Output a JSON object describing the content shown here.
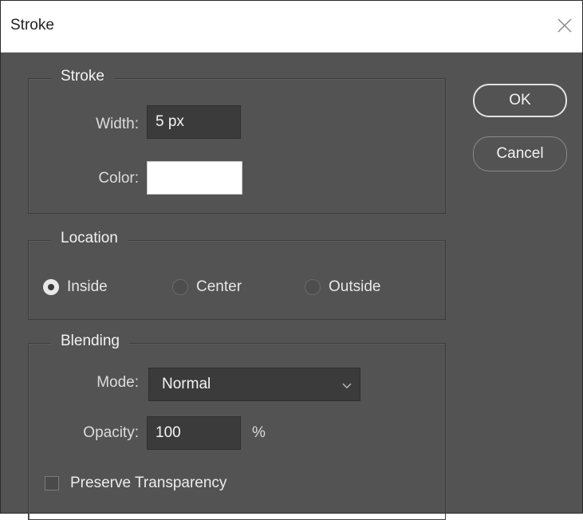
{
  "dialog": {
    "title": "Stroke"
  },
  "stroke_group": {
    "legend": "Stroke",
    "width_label": "Width:",
    "width_value": "5 px",
    "color_label": "Color:",
    "color_value": "#ffffff"
  },
  "location_group": {
    "legend": "Location",
    "options": [
      {
        "label": "Inside",
        "selected": true
      },
      {
        "label": "Center",
        "selected": false
      },
      {
        "label": "Outside",
        "selected": false
      }
    ]
  },
  "blending_group": {
    "legend": "Blending",
    "mode_label": "Mode:",
    "mode_value": "Normal",
    "opacity_label": "Opacity:",
    "opacity_value": "100",
    "opacity_unit": "%",
    "preserve_label": "Preserve Transparency",
    "preserve_checked": false
  },
  "buttons": {
    "ok": "OK",
    "cancel": "Cancel"
  },
  "icons": {
    "close": "close-icon",
    "dropdown": "chevron-down-icon"
  }
}
